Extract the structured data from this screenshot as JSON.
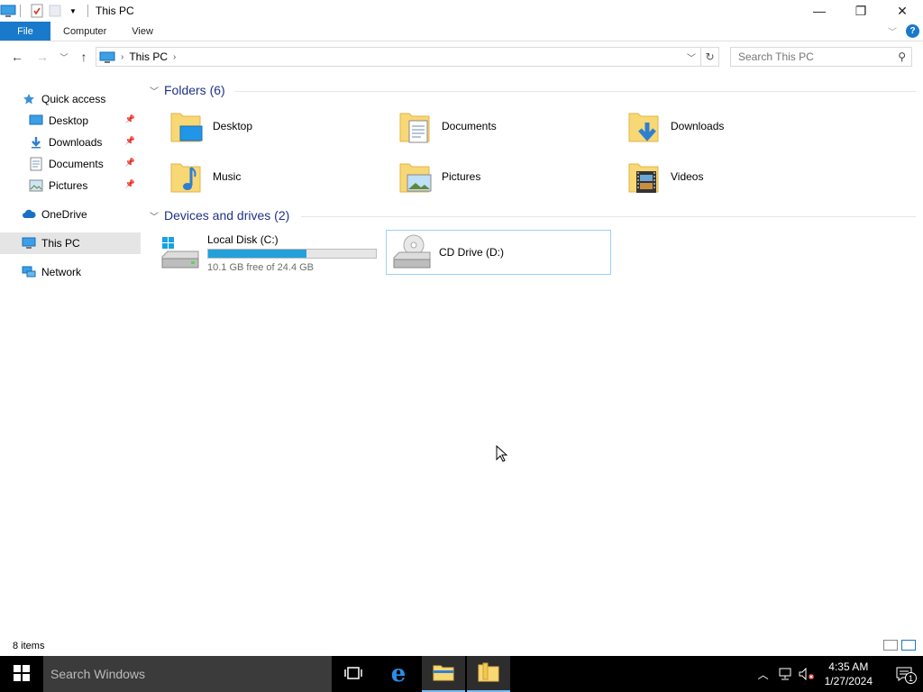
{
  "titlebar": {
    "title": "This PC",
    "minimize": "—",
    "restore": "❐",
    "close": "✕"
  },
  "ribbon": {
    "tabs": [
      {
        "label": "File"
      },
      {
        "label": "Computer"
      },
      {
        "label": "View"
      }
    ],
    "help": "?"
  },
  "address": {
    "crumb": "This PC",
    "search_placeholder": "Search This PC"
  },
  "sidebar": {
    "items": [
      {
        "label": "Quick access",
        "icon": "star-icon"
      },
      {
        "label": "Desktop",
        "icon": "desktop-icon",
        "pinned": true
      },
      {
        "label": "Downloads",
        "icon": "download-icon",
        "pinned": true
      },
      {
        "label": "Documents",
        "icon": "documents-icon",
        "pinned": true
      },
      {
        "label": "Pictures",
        "icon": "pictures-icon",
        "pinned": true
      },
      {
        "label": "OneDrive",
        "icon": "cloud-icon"
      },
      {
        "label": "This PC",
        "icon": "computer-icon",
        "selected": true
      },
      {
        "label": "Network",
        "icon": "network-icon"
      }
    ]
  },
  "folders": {
    "header": "Folders (6)",
    "items": [
      {
        "label": "Desktop"
      },
      {
        "label": "Documents"
      },
      {
        "label": "Downloads"
      },
      {
        "label": "Music"
      },
      {
        "label": "Pictures"
      },
      {
        "label": "Videos"
      }
    ]
  },
  "devices": {
    "header": "Devices and drives (2)",
    "items": [
      {
        "label": "Local Disk (C:)",
        "free_text": "10.1 GB free of 24.4 GB",
        "used_fraction": 0.586
      },
      {
        "label": "CD Drive (D:)"
      }
    ]
  },
  "status": {
    "items_count": "8 items"
  },
  "taskbar": {
    "search_placeholder": "Search Windows",
    "time": "4:35 AM",
    "date": "1/27/2024",
    "notification_count": "1"
  },
  "colors": {
    "accent": "#1979ca",
    "drive_bar": "#26a0da",
    "group_header": "#1e3287",
    "folder": "#f8d775"
  }
}
